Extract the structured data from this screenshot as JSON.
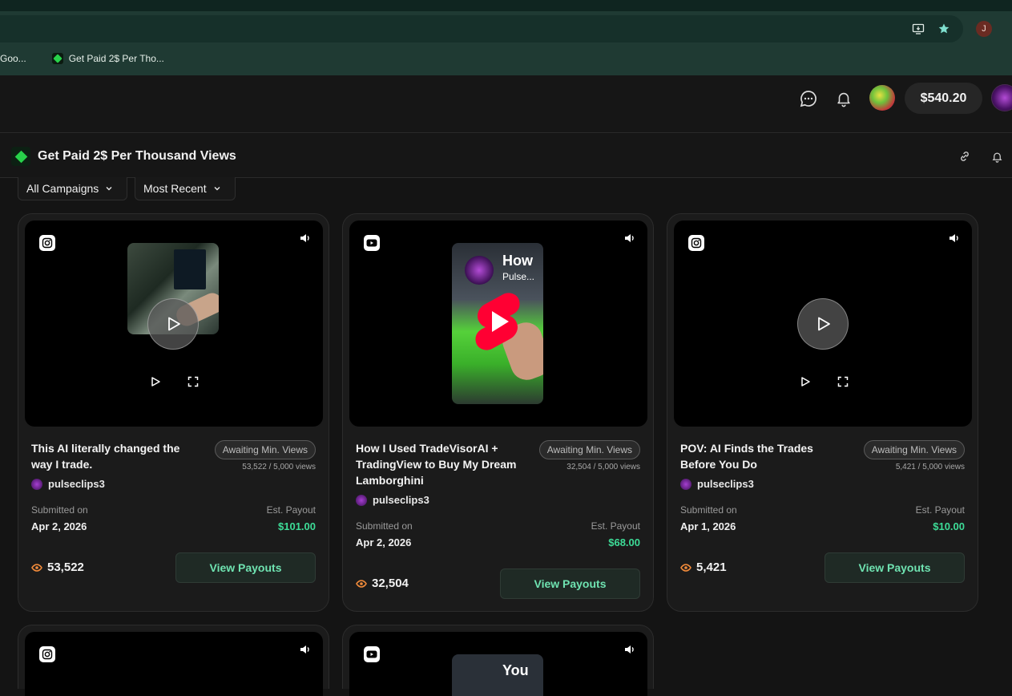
{
  "browser": {
    "bookmarks": [
      {
        "label": "Goo..."
      },
      {
        "label": "Get Paid 2$ Per Tho..."
      }
    ],
    "profile_initial": "J"
  },
  "header": {
    "balance": "$540.20"
  },
  "campaign": {
    "title": "Get Paid 2$ Per Thousand Views"
  },
  "filters": {
    "campaigns": "All Campaigns",
    "sort": "Most Recent"
  },
  "cards": [
    {
      "platform": "instagram",
      "title": "This AI literally changed the way I trade.",
      "status": "Awaiting Min. Views",
      "views_progress": "53,522 / 5,000 views",
      "creator": "pulseclips3",
      "submitted_label": "Submitted on",
      "submitted_date": "Apr 2, 2026",
      "payout_label": "Est. Payout",
      "payout": "$101.00",
      "view_count": "53,522",
      "button": "View Payouts"
    },
    {
      "platform": "youtube",
      "thumb_text": "How",
      "thumb_subtext": "Pulse...",
      "title": "How I Used TradeVisorAI + TradingView to Buy My Dream Lamborghini",
      "status": "Awaiting Min. Views",
      "views_progress": "32,504 / 5,000 views",
      "creator": "pulseclips3",
      "submitted_label": "Submitted on",
      "submitted_date": "Apr 2, 2026",
      "payout_label": "Est. Payout",
      "payout": "$68.00",
      "view_count": "32,504",
      "button": "View Payouts"
    },
    {
      "platform": "instagram",
      "title": "POV: AI Finds the Trades Before You Do",
      "status": "Awaiting Min. Views",
      "views_progress": "5,421 / 5,000 views",
      "creator": "pulseclips3",
      "submitted_label": "Submitted on",
      "submitted_date": "Apr 1, 2026",
      "payout_label": "Est. Payout",
      "payout": "$10.00",
      "view_count": "5,421",
      "button": "View Payouts"
    },
    {
      "platform": "instagram"
    },
    {
      "platform": "youtube",
      "thumb_text": "You"
    }
  ]
}
